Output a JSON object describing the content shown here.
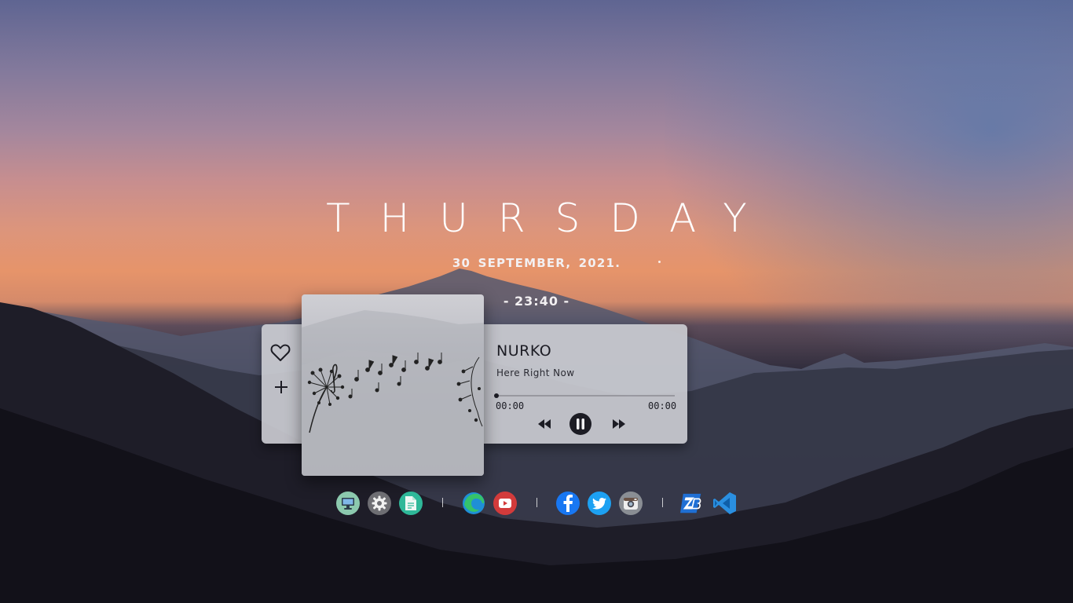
{
  "clock": {
    "day": "THURSDAY",
    "date": "30  SEPTEMBER,  2021.",
    "time": "- 23:40 -"
  },
  "player": {
    "artist": "NURKO",
    "song": "Here Right Now",
    "time_current": "00:00",
    "time_total": "00:00",
    "progress": 0,
    "state": "playing"
  },
  "icons": {
    "like": "heart-icon",
    "add": "plus-icon",
    "prev": "rewind-icon",
    "pause": "pause-icon",
    "next": "fast-forward-icon"
  },
  "dock": [
    {
      "name": "this-pc",
      "icon": "monitor-icon",
      "color": "#7fc3a6"
    },
    {
      "name": "settings",
      "icon": "gear-icon",
      "color": "#6d6d72"
    },
    {
      "name": "notes",
      "icon": "document-icon",
      "color": "#2fb899"
    },
    {
      "name": "edge",
      "icon": "edge-browser-icon",
      "color": "#1e88d0"
    },
    {
      "name": "youtube",
      "icon": "youtube-icon",
      "color": "#d63a3a"
    },
    {
      "name": "facebook",
      "icon": "facebook-icon",
      "color": "#1877f2"
    },
    {
      "name": "twitter",
      "icon": "twitter-icon",
      "color": "#1da1f2"
    },
    {
      "name": "camera",
      "icon": "camera-icon",
      "color": "#8a8e94"
    },
    {
      "name": "zb-app",
      "icon": "zb-logo-icon",
      "color": "#1f6fd4"
    },
    {
      "name": "vscode",
      "icon": "vscode-icon",
      "color": "#2a8fe0"
    }
  ]
}
